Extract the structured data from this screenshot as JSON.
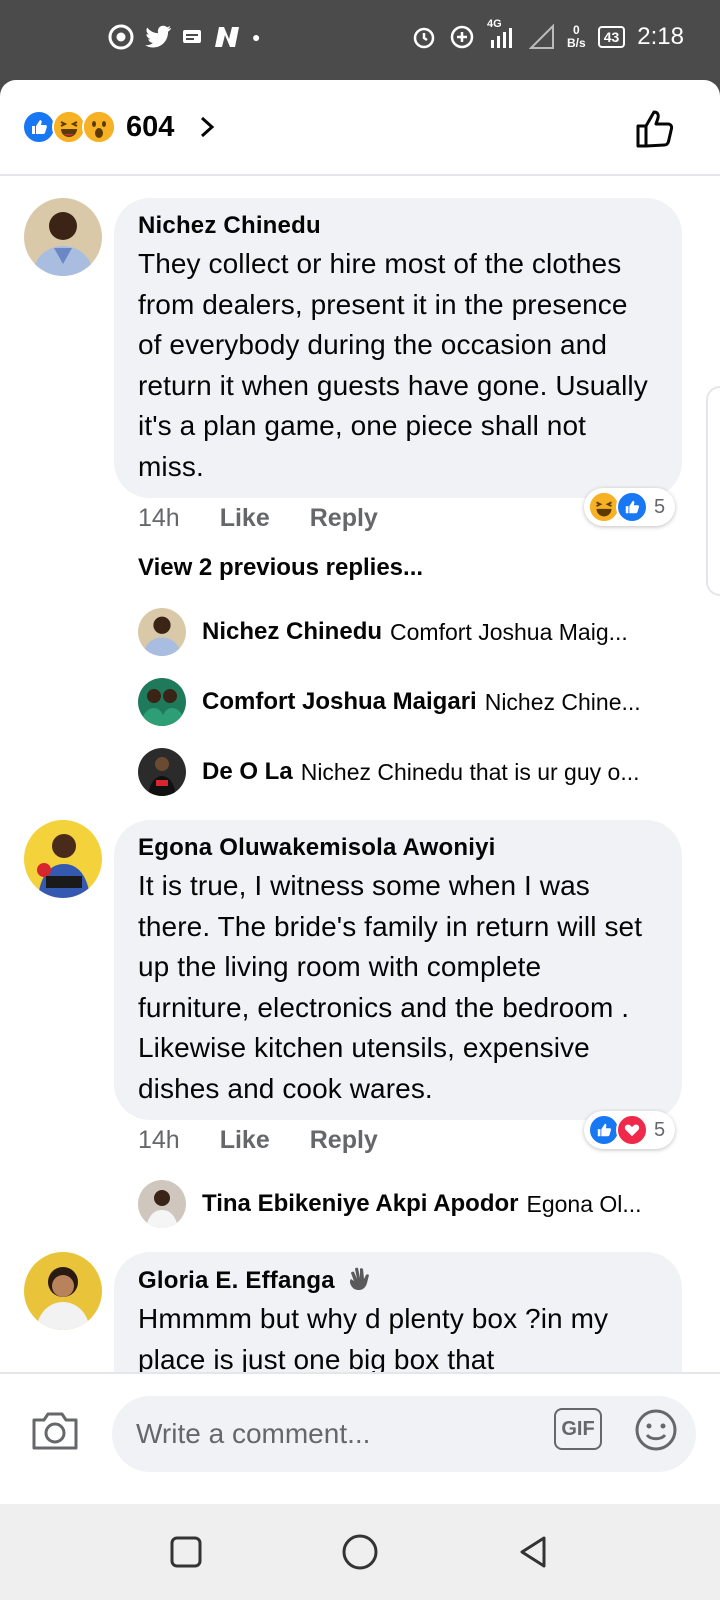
{
  "status_bar": {
    "network": "4G",
    "net_speed_value": "0",
    "net_speed_unit": "B/s",
    "battery": "43",
    "time": "2:18"
  },
  "header": {
    "reaction_count": "604",
    "reaction_icons": [
      "like",
      "haha",
      "wow"
    ]
  },
  "comments": [
    {
      "author": "Nichez Chinedu",
      "text": "They collect or hire most of the clothes from dealers, present it in the presence of everybody during the occasion and return it when guests have gone. Usually it's a plan game, one piece shall not miss.",
      "time": "14h",
      "like_label": "Like",
      "reply_label": "Reply",
      "reactions": {
        "icons": [
          "haha",
          "like"
        ],
        "count": "5"
      },
      "view_previous": "View 2 previous replies...",
      "replies": [
        {
          "author": "Nichez Chinedu",
          "snippet": "Comfort Joshua Maig..."
        },
        {
          "author": "Comfort Joshua Maigari",
          "snippet": "Nichez Chine..."
        },
        {
          "author": "De O La",
          "snippet": "Nichez Chinedu that is ur guy o..."
        }
      ]
    },
    {
      "author": "Egona Oluwakemisola Awoniyi",
      "text": "It is true, I witness some when I was there. The bride's family in return will set up the living room with complete furniture, electronics and the bedroom .  Likewise kitchen utensils, expensive dishes and cook wares.",
      "time": "14h",
      "like_label": "Like",
      "reply_label": "Reply",
      "reactions": {
        "icons": [
          "like",
          "love"
        ],
        "count": "5"
      },
      "replies": [
        {
          "author": "Tina Ebikeniye Akpi Apodor",
          "snippet": "Egona Ol..."
        }
      ]
    },
    {
      "author": "Gloria E. Effanga",
      "author_icon": "waving-hand-icon",
      "text": "Hmmmm but why d plenty  box ?in my place is just one big box that"
    }
  ],
  "composer": {
    "placeholder": "Write a comment...",
    "gif_label": "GIF"
  },
  "colors": {
    "facebook_blue": "#1877f2",
    "bubble_bg": "#f0f2f5",
    "secondary_text": "#65676b"
  }
}
